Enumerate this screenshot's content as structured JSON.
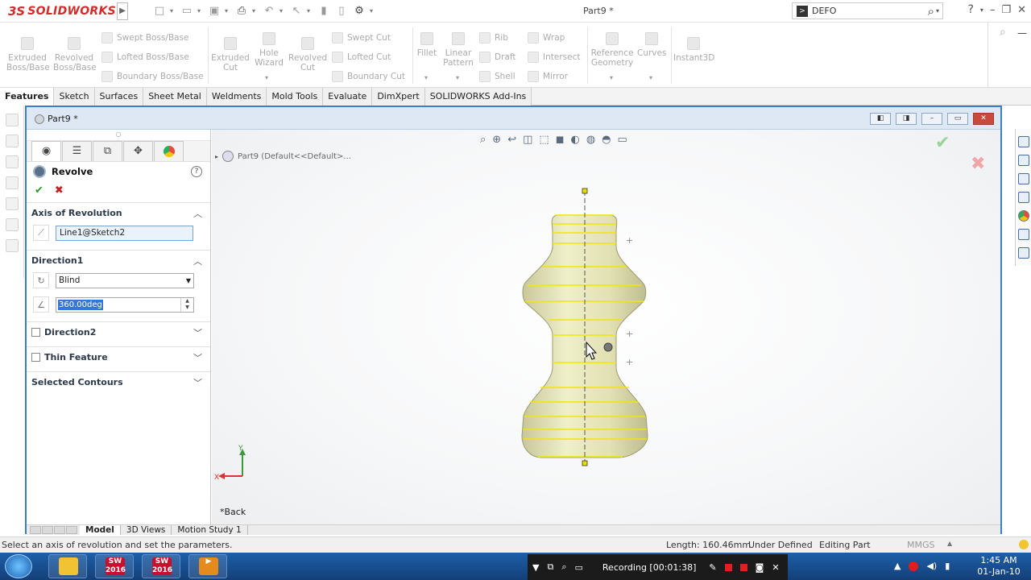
{
  "app": {
    "logo_prefix": "3S",
    "logo_name": "SOLIDWORKS",
    "document_title": "Part9 *",
    "search_value": "DEFO"
  },
  "ribbon": {
    "tools": [
      {
        "key": "extruded-boss",
        "label": "Extruded\nBoss/Base"
      },
      {
        "key": "revolved-boss",
        "label": "Revolved\nBoss/Base"
      },
      {
        "key": "extruded-cut",
        "label": "Extruded\nCut"
      },
      {
        "key": "hole-wizard",
        "label": "Hole\nWizard"
      },
      {
        "key": "revolved-cut",
        "label": "Revolved\nCut"
      },
      {
        "key": "fillet",
        "label": "Fillet"
      },
      {
        "key": "linear-pattern",
        "label": "Linear\nPattern"
      },
      {
        "key": "reference-geometry",
        "label": "Reference\nGeometry"
      },
      {
        "key": "curves",
        "label": "Curves"
      },
      {
        "key": "instant3d",
        "label": "Instant3D"
      }
    ],
    "small_tools": [
      {
        "key": "swept-boss",
        "label": "Swept Boss/Base"
      },
      {
        "key": "lofted-boss",
        "label": "Lofted Boss/Base"
      },
      {
        "key": "boundary-boss",
        "label": "Boundary Boss/Base"
      },
      {
        "key": "swept-cut",
        "label": "Swept Cut"
      },
      {
        "key": "lofted-cut",
        "label": "Lofted Cut"
      },
      {
        "key": "boundary-cut",
        "label": "Boundary Cut"
      },
      {
        "key": "rib",
        "label": "Rib"
      },
      {
        "key": "draft",
        "label": "Draft"
      },
      {
        "key": "shell",
        "label": "Shell"
      },
      {
        "key": "wrap",
        "label": "Wrap"
      },
      {
        "key": "intersect",
        "label": "Intersect"
      },
      {
        "key": "mirror",
        "label": "Mirror"
      }
    ]
  },
  "tabs": [
    "Features",
    "Sketch",
    "Surfaces",
    "Sheet Metal",
    "Weldments",
    "Mold Tools",
    "Evaluate",
    "DimXpert",
    "SOLIDWORKS Add-Ins"
  ],
  "docwin": {
    "title": "Part9 *",
    "tree_flyout": "Part9  (Default<<Default>..."
  },
  "pm": {
    "feature_title": "Revolve",
    "axis_group": "Axis of Revolution",
    "axis_value": "Line1@Sketch2",
    "direction1_group": "Direction1",
    "end_condition": "Blind",
    "angle_value": "360.00deg",
    "direction2_group": "Direction2",
    "thin_feature_group": "Thin Feature",
    "selected_contours_group": "Selected Contours"
  },
  "gfx": {
    "view_label": "*Back",
    "triad_y": "Y",
    "triad_x": "X"
  },
  "model_tabs": [
    "Model",
    "3D Views",
    "Motion Study 1"
  ],
  "status": {
    "message": "Select an axis of revolution and set the parameters.",
    "length": "Length: 160.46mm",
    "state": "Under Defined",
    "mode": "Editing Part",
    "units": "MMGS"
  },
  "taskbar": {
    "recording": "Recording [00:01:38]",
    "time": "1:45 AM",
    "date": "01-Jan-10",
    "sw_label_1": "2016",
    "sw_label_2": "2016"
  },
  "colors": {
    "accent": "#3a7ec9",
    "solidworks_red": "#d22b2b",
    "part_fill": "#e9e9bd",
    "preview_line": "#f2e600"
  }
}
